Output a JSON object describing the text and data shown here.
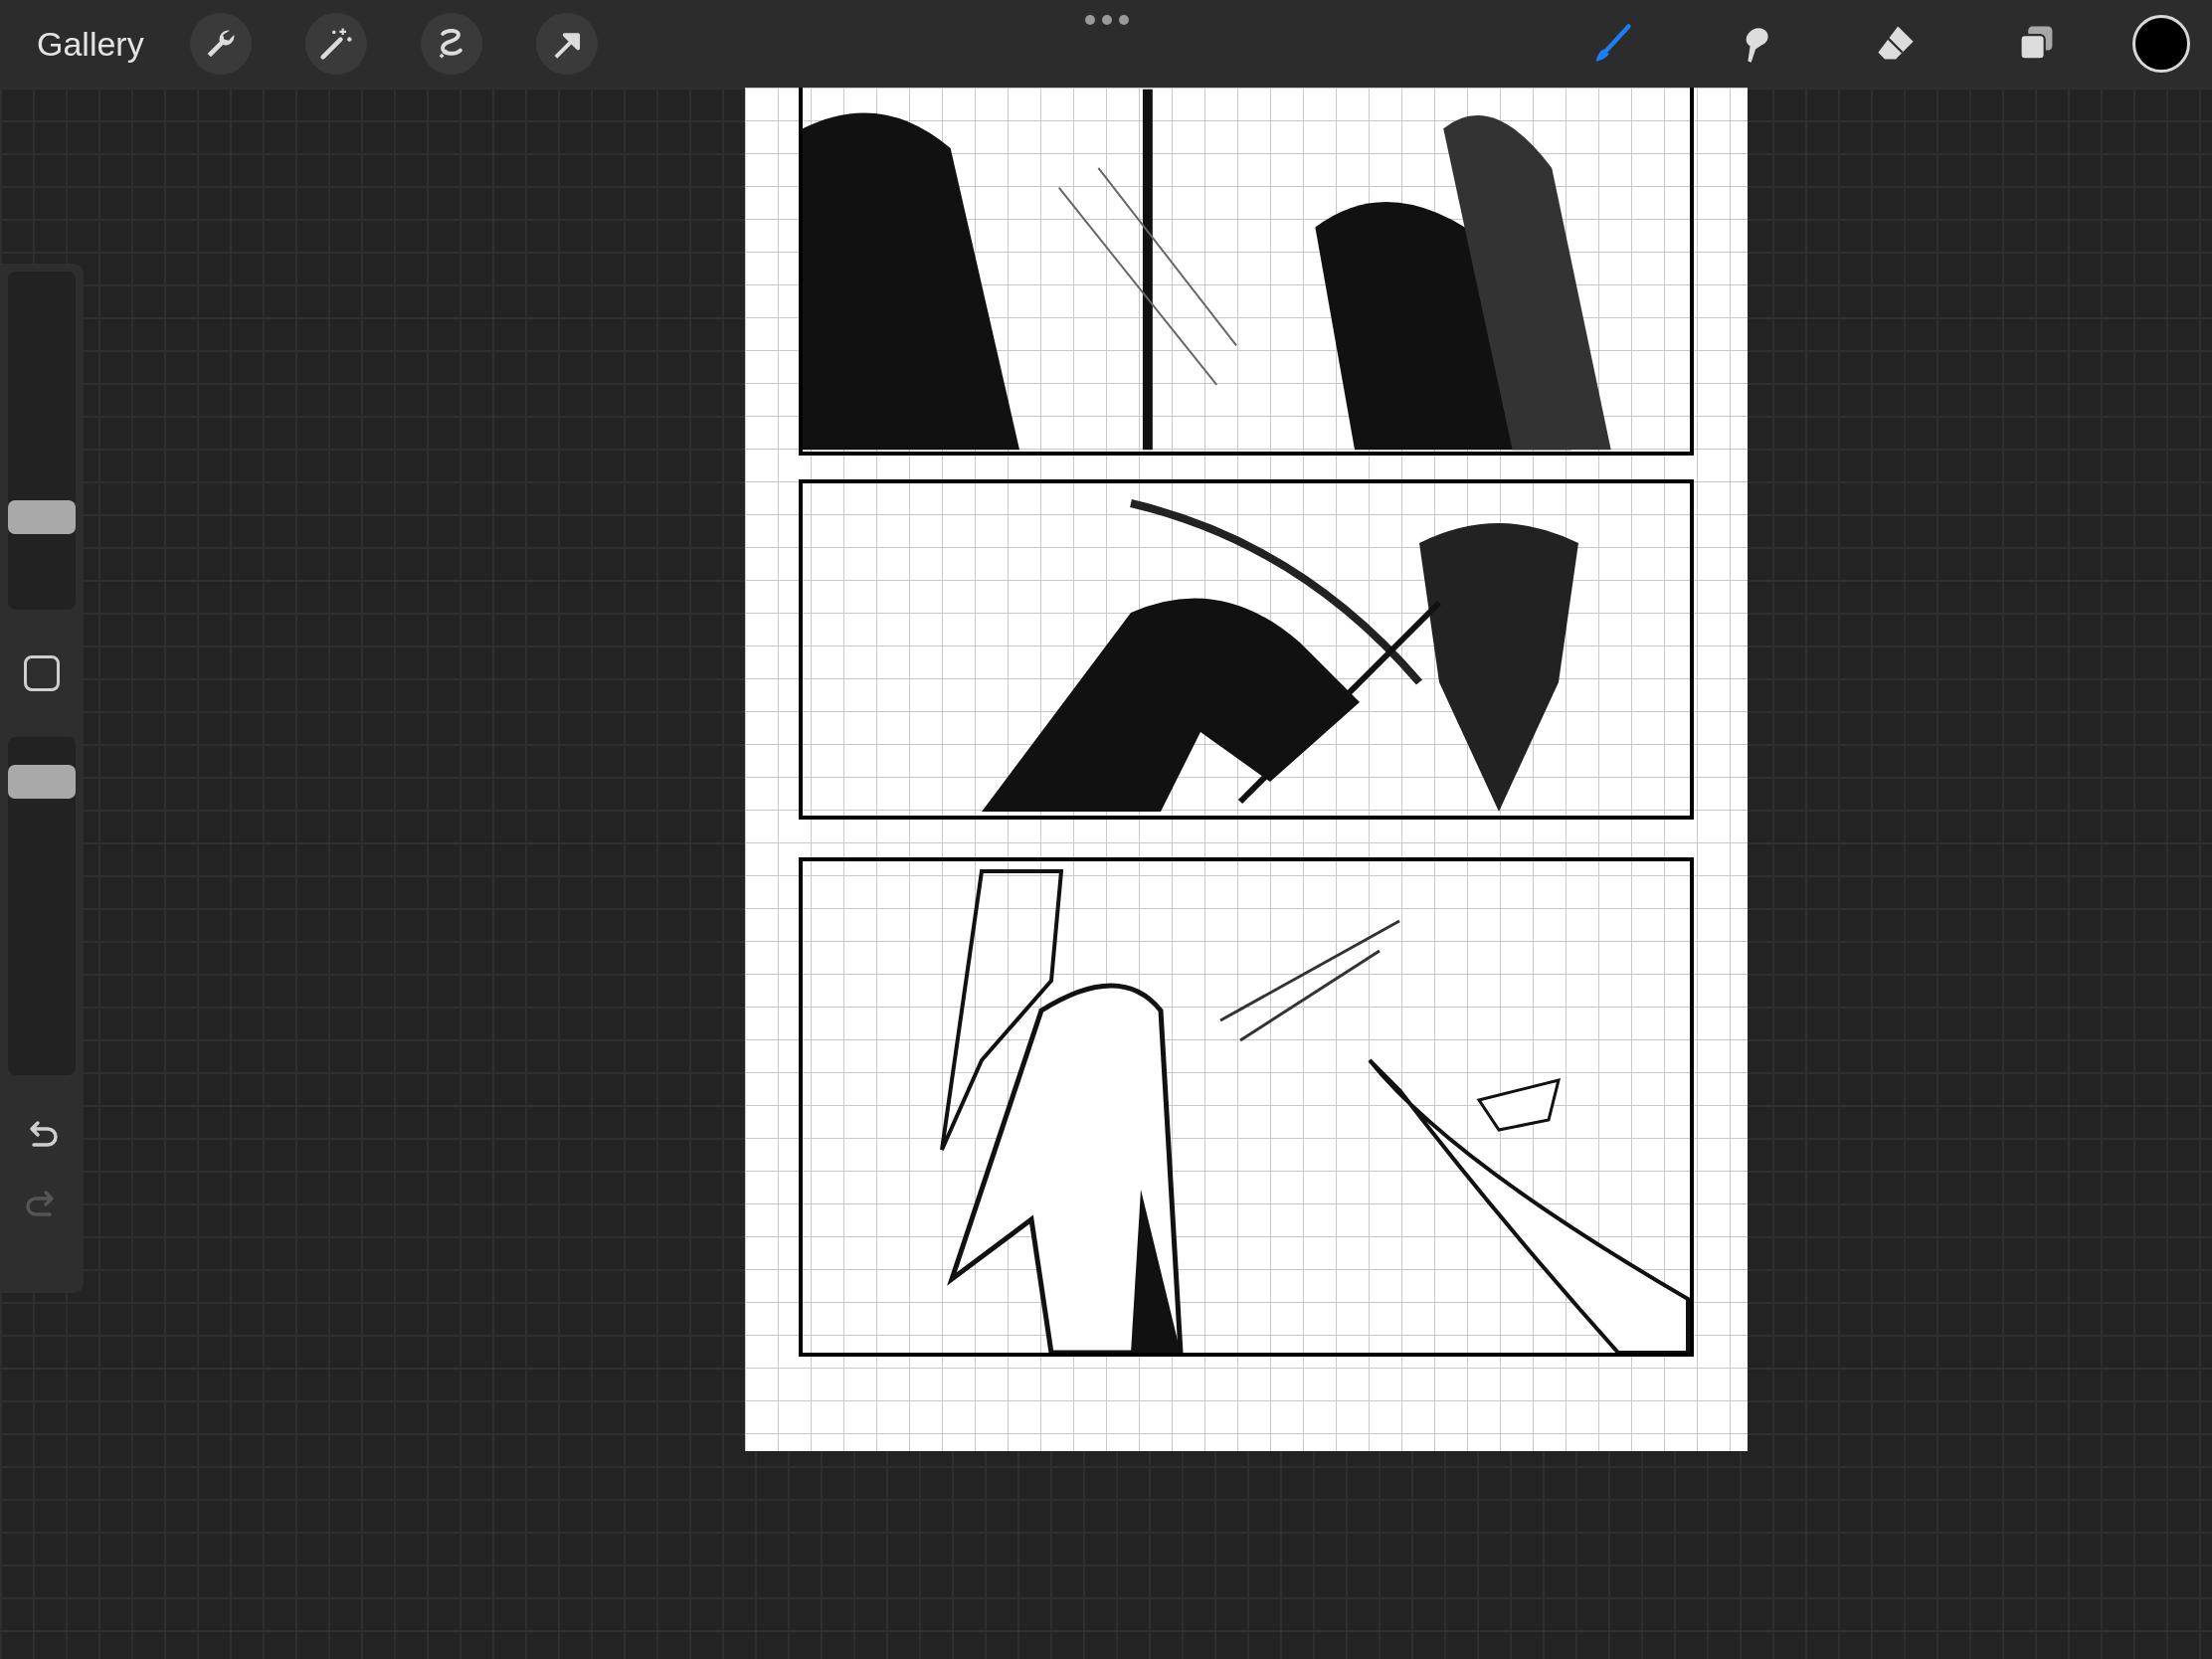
{
  "toolbar": {
    "gallery": "Gallery",
    "left_tools": [
      {
        "kind": "wrench"
      },
      {
        "kind": "wand"
      },
      {
        "kind": "selection"
      },
      {
        "kind": "transform"
      }
    ],
    "right_tools": [
      {
        "kind": "brush",
        "selected": true
      },
      {
        "kind": "smudge",
        "selected": false
      },
      {
        "kind": "eraser",
        "selected": false
      },
      {
        "kind": "layers",
        "selected": false
      }
    ]
  },
  "sidebar": {
    "size_slider": {
      "level": 0.25
    },
    "opacity_slider": {
      "level": 0.91
    },
    "undo": {
      "disabled": false
    },
    "redo": {
      "disabled": true
    }
  }
}
